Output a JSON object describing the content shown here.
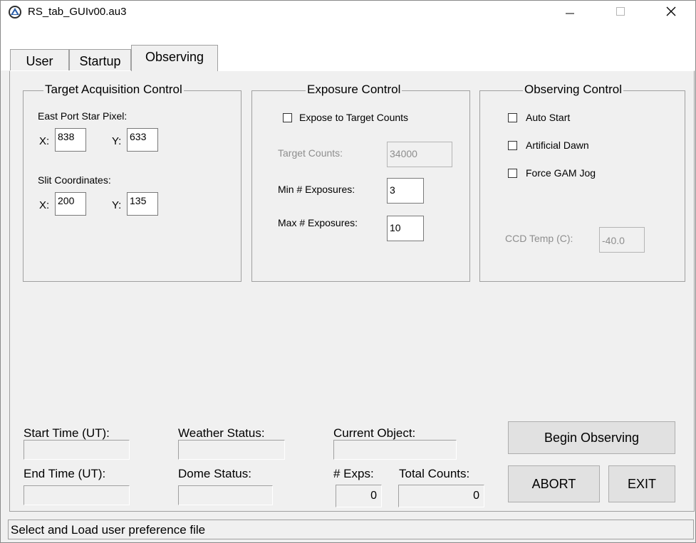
{
  "window": {
    "title": "RS_tab_GUIv00.au3"
  },
  "tabs": [
    {
      "label": "User"
    },
    {
      "label": "Startup"
    },
    {
      "label": "Observing"
    }
  ],
  "target_acquisition": {
    "title": "Target Acquisition Control",
    "east_port_label": "East Port Star Pixel:",
    "slit_label": "Slit Coordinates:",
    "x_label": "X:",
    "y_label": "Y:",
    "east_x": "838",
    "east_y": "633",
    "slit_x": "200",
    "slit_y": "135"
  },
  "exposure_control": {
    "title": "Exposure Control",
    "expose_to_target_label": "Expose to Target Counts",
    "target_counts_label": "Target Counts:",
    "target_counts_value": "34000",
    "min_exposures_label": "Min # Exposures:",
    "min_exposures_value": "3",
    "max_exposures_label": "Max # Exposures:",
    "max_exposures_value": "10"
  },
  "observing_control": {
    "title": "Observing Control",
    "auto_start_label": "Auto Start",
    "artificial_dawn_label": "Artificial Dawn",
    "force_gam_jog_label": "Force GAM Jog",
    "ccd_temp_label": "CCD Temp (C):",
    "ccd_temp_value": "-40.0"
  },
  "status": {
    "start_time_label": "Start Time (UT):",
    "end_time_label": "End Time (UT):",
    "weather_status_label": "Weather Status:",
    "dome_status_label": "Dome Status:",
    "current_object_label": "Current Object:",
    "exps_label": "# Exps:",
    "exps_value": "0",
    "total_counts_label": "Total Counts:",
    "total_counts_value": "0"
  },
  "buttons": {
    "begin_observing": "Begin Observing",
    "abort": "ABORT",
    "exit": "EXIT"
  },
  "statusbar": {
    "text": "Select and Load user preference file"
  }
}
